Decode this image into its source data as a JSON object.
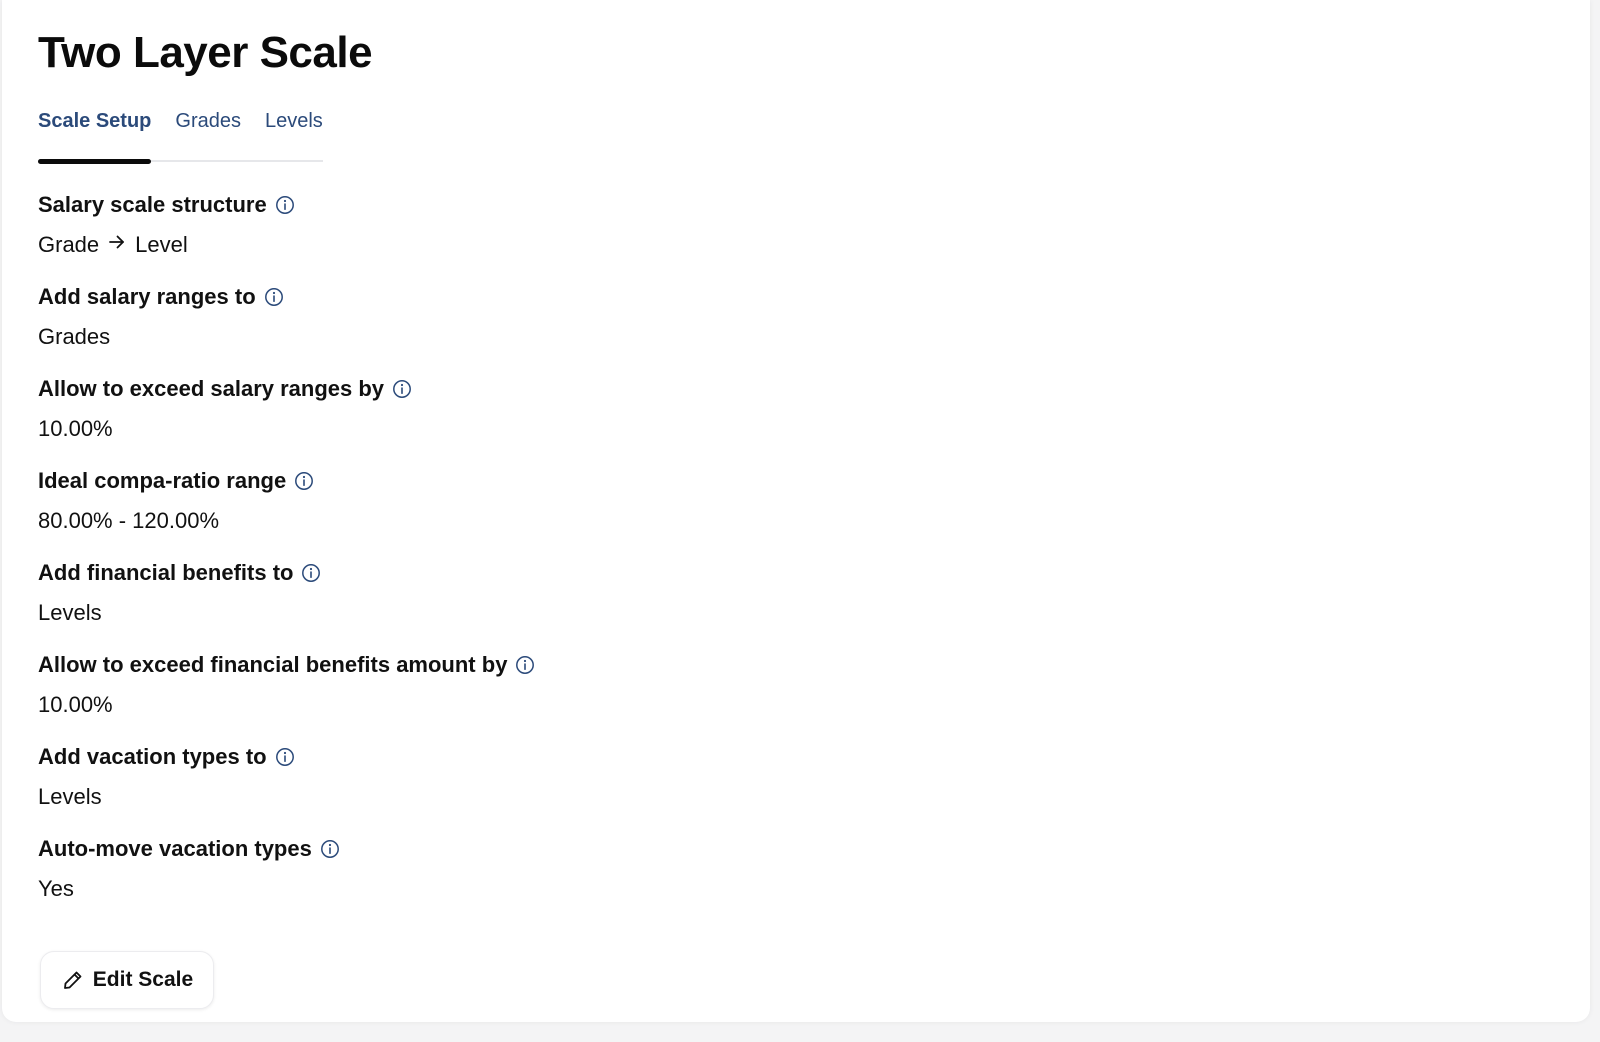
{
  "page": {
    "title": "Two Layer Scale"
  },
  "tabs": [
    {
      "label": "Scale Setup",
      "active": true
    },
    {
      "label": "Grades",
      "active": false
    },
    {
      "label": "Levels",
      "active": false
    }
  ],
  "fields": {
    "salary_scale_structure": {
      "label": "Salary scale structure",
      "value_from": "Grade",
      "value_to": "Level"
    },
    "add_salary_ranges_to": {
      "label": "Add salary ranges to",
      "value": "Grades"
    },
    "allow_exceed_salary_ranges": {
      "label": "Allow to exceed salary ranges by",
      "value": "10.00%"
    },
    "ideal_compa_ratio": {
      "label": "Ideal compa-ratio range",
      "value": "80.00% - 120.00%"
    },
    "add_financial_benefits_to": {
      "label": "Add financial benefits to",
      "value": "Levels"
    },
    "allow_exceed_financial_benefits": {
      "label": "Allow to exceed financial benefits amount by",
      "value": "10.00%"
    },
    "add_vacation_types_to": {
      "label": "Add vacation types to",
      "value": "Levels"
    },
    "auto_move_vacation_types": {
      "label": "Auto-move vacation types",
      "value": "Yes"
    }
  },
  "actions": {
    "edit_label": "Edit Scale"
  },
  "icons": {
    "info": "info-circle-icon",
    "arrow": "arrow-right-icon",
    "edit": "pencil-icon"
  },
  "colors": {
    "tab_text": "#2b4a7a",
    "info_icon": "#2b4a7a",
    "active_underline": "#0b0b0b"
  }
}
